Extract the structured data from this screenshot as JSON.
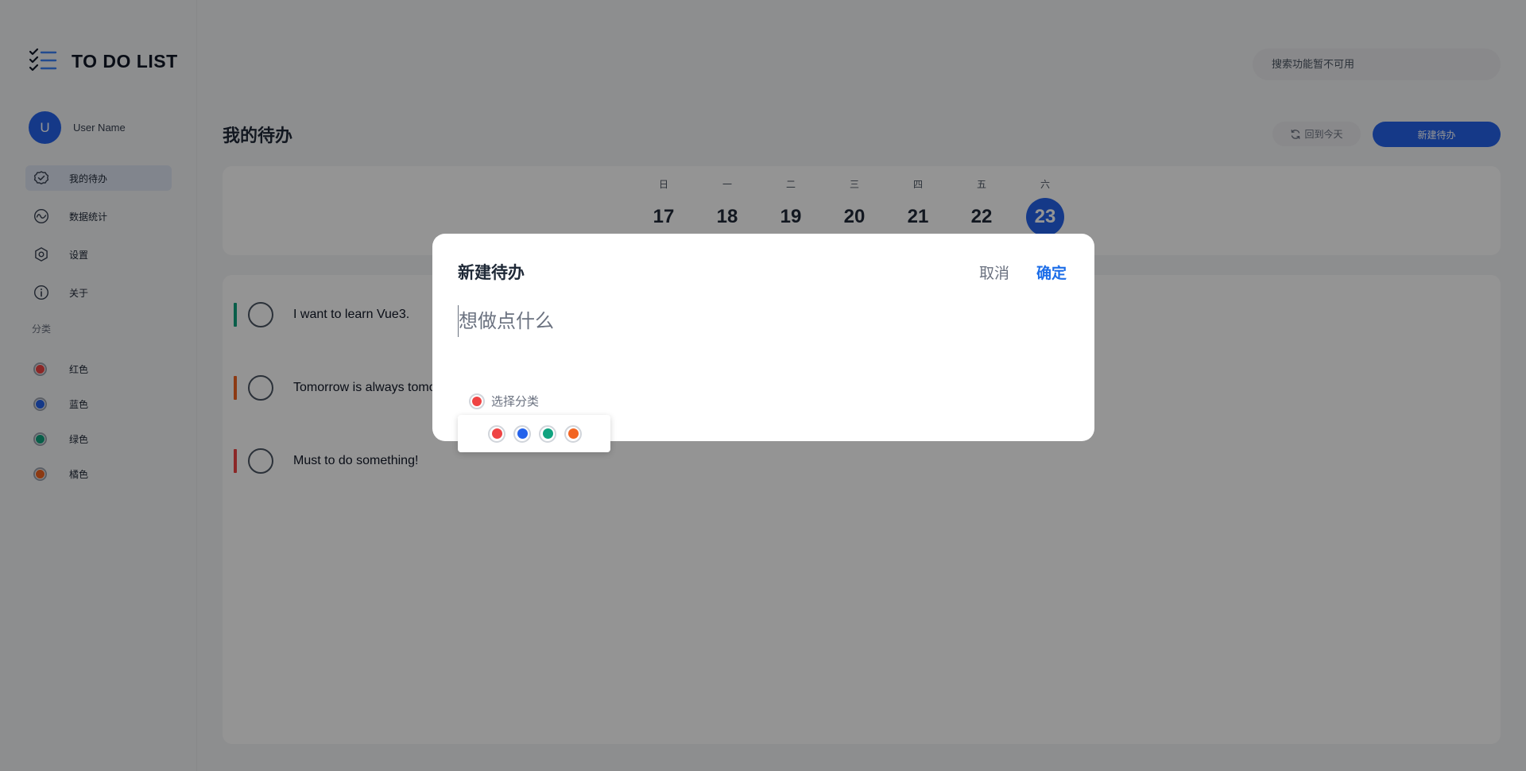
{
  "app": {
    "title": "TO DO LIST"
  },
  "user": {
    "initial": "U",
    "name": "User Name"
  },
  "sidebar": {
    "nav": [
      {
        "label": "我的待办",
        "icon": "check-circle-icon",
        "active": true
      },
      {
        "label": "数据统计",
        "icon": "chart-wave-icon",
        "active": false
      },
      {
        "label": "设置",
        "icon": "settings-icon",
        "active": false
      },
      {
        "label": "关于",
        "icon": "info-icon",
        "active": false
      }
    ],
    "section_label": "分类",
    "categories": [
      {
        "label": "红色",
        "color": "#ef4444"
      },
      {
        "label": "蓝色",
        "color": "#2563eb"
      },
      {
        "label": "绿色",
        "color": "#10a37f"
      },
      {
        "label": "橘色",
        "color": "#f26522"
      }
    ]
  },
  "header": {
    "search_placeholder": "搜索功能暂不可用",
    "page_title": "我的待办",
    "today_button": "回到今天",
    "new_button": "新建待办"
  },
  "week": [
    {
      "weekday": "日",
      "day": "17",
      "selected": false
    },
    {
      "weekday": "一",
      "day": "18",
      "selected": false
    },
    {
      "weekday": "二",
      "day": "19",
      "selected": false
    },
    {
      "weekday": "三",
      "day": "20",
      "selected": false
    },
    {
      "weekday": "四",
      "day": "21",
      "selected": false
    },
    {
      "weekday": "五",
      "day": "22",
      "selected": false
    },
    {
      "weekday": "六",
      "day": "23",
      "selected": true
    }
  ],
  "todos": [
    {
      "text": "I want to learn Vue3.",
      "color": "#10a37f"
    },
    {
      "text": "Tomorrow is always tomorrow.",
      "color": "#f26522"
    },
    {
      "text": "Must to do something!",
      "color": "#ef4444"
    }
  ],
  "modal": {
    "title": "新建待办",
    "cancel": "取消",
    "confirm": "确定",
    "input_placeholder": "想做点什么",
    "category_placeholder": "选择分类",
    "selected_color": "#ef4444",
    "colors": [
      "#ef4444",
      "#2563eb",
      "#10a37f",
      "#f26522"
    ]
  }
}
